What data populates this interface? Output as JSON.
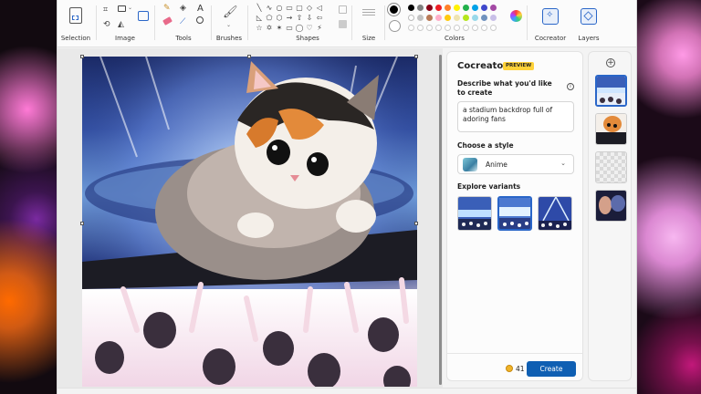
{
  "ribbon": {
    "groups": [
      {
        "id": "selection",
        "label": "Selection"
      },
      {
        "id": "image",
        "label": "Image"
      },
      {
        "id": "tools",
        "label": "Tools"
      },
      {
        "id": "brushes",
        "label": "Brushes"
      },
      {
        "id": "shapes",
        "label": "Shapes"
      },
      {
        "id": "size",
        "label": "Size"
      },
      {
        "id": "colors",
        "label": "Colors"
      },
      {
        "id": "cocreator",
        "label": "Cocreator"
      },
      {
        "id": "layers",
        "label": "Layers"
      }
    ],
    "tools_text_glyph": "A",
    "shape_glyphs": [
      "╲",
      "∿",
      "○",
      "▭",
      "▢",
      "◇",
      "◁",
      "◺",
      "⬠",
      "⬡",
      "→",
      "⇧",
      "⇩",
      "⇦",
      "☆",
      "✡",
      "✶",
      "▭",
      "◯",
      "♡",
      "⚡"
    ],
    "palette": [
      "#000000",
      "#7f7f7f",
      "#880015",
      "#ed1c24",
      "#ff7f27",
      "#fff200",
      "#22b14c",
      "#00a2e8",
      "#3f48cc",
      "#a349a4",
      "#ffffff",
      "#c3c3c3",
      "#b97a57",
      "#ffaec9",
      "#ffc90e",
      "#efe4b0",
      "#b5e61d",
      "#99d9ea",
      "#7092be",
      "#c8bfe7"
    ],
    "primary_color": "#000000",
    "secondary_color": "#ffffff"
  },
  "cocreator": {
    "title": "Cocreator",
    "badge": "PREVIEW",
    "describe_label": "Describe what you'd like to create",
    "info_icon": "i",
    "prompt": "a stadium backdrop full of adoring fans",
    "style_label": "Choose a style",
    "style_value": "Anime",
    "style_chevron": "⌄",
    "variants_label": "Explore variants",
    "variants_selected_index": 1,
    "credits": "41",
    "create_button": "Create"
  },
  "layers": {
    "add_glyph": "+",
    "active_index": 0
  }
}
